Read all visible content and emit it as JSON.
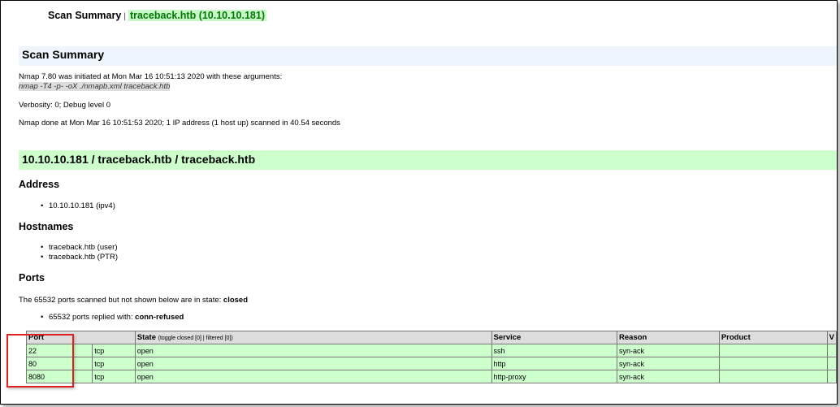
{
  "header": {
    "title": "Scan Summary",
    "separator": "|",
    "target": "traceback.htb (10.10.10.181)"
  },
  "summary": {
    "heading": "Scan Summary",
    "initiated": "Nmap 7.80 was initiated at Mon Mar 16 10:51:13 2020 with these arguments:",
    "arguments": "nmap -T4 -p- -oX ./nmapb.xml traceback.htb",
    "verbosity": "Verbosity: 0; Debug level 0",
    "done": "Nmap done at Mon Mar 16 10:51:53 2020; 1 IP address (1 host up) scanned in 40.54 seconds"
  },
  "host": {
    "heading": "10.10.10.181 / traceback.htb / traceback.htb",
    "address_heading": "Address",
    "addresses": [
      "10.10.10.181 (ipv4)"
    ],
    "hostnames_heading": "Hostnames",
    "hostnames": [
      "traceback.htb (user)",
      "traceback.htb (PTR)"
    ],
    "ports_heading": "Ports",
    "closed_note_prefix": "The 65532 ports scanned but not shown below are in state: ",
    "closed_state": "closed",
    "replied_prefix": "65532 ports replied with: ",
    "replied_reason": "conn-refused"
  },
  "ports_table": {
    "headers": {
      "port": "Port",
      "state": "State",
      "state_toggle": "(toggle closed [0] | filtered [0])",
      "service": "Service",
      "reason": "Reason",
      "product": "Product",
      "version": "V"
    },
    "rows": [
      {
        "port": "22",
        "proto": "tcp",
        "state": "open",
        "service": "ssh",
        "reason": "syn-ack",
        "product": "",
        "version": ""
      },
      {
        "port": "80",
        "proto": "tcp",
        "state": "open",
        "service": "http",
        "reason": "syn-ack",
        "product": "",
        "version": ""
      },
      {
        "port": "8080",
        "proto": "tcp",
        "state": "open",
        "service": "http-proxy",
        "reason": "syn-ack",
        "product": "",
        "version": ""
      }
    ]
  },
  "colors": {
    "summary_band": "#eef5fd",
    "host_band": "#ccffcc",
    "open_row": "#ccffcc",
    "highlight_box": "#e02020"
  }
}
